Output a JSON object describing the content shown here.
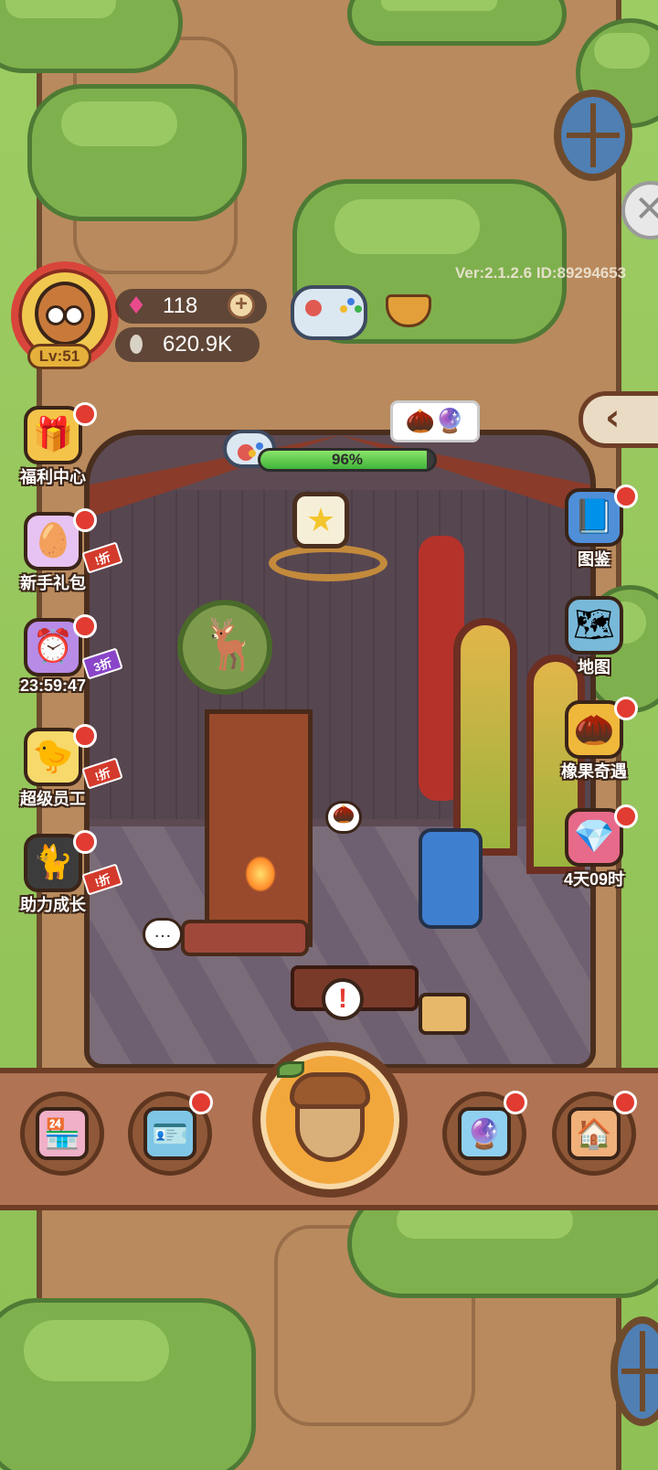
{
  "hud": {
    "level": "Lv:51",
    "gems": "118",
    "seeds": "620.9K",
    "version": "Ver:2.1.2.6 ID:89294653",
    "icons": {
      "gem": "gem-icon",
      "seed": "sunflower-seed-icon",
      "add": "plus-icon",
      "gamepad": "gamepad-icon",
      "bowl": "hotpot-icon"
    }
  },
  "room": {
    "progress": 0.96,
    "progress_label": "96%",
    "star_icon": "★",
    "alert_icon": "!",
    "chat_icon": "…"
  },
  "left_menu": [
    {
      "label": "福利中心",
      "icon": "gift-icon",
      "emoji": "🎁",
      "color": "#f4c34a",
      "badge": ""
    },
    {
      "label": "新手礼包",
      "icon": "egg-clock-icon",
      "emoji": "🥚",
      "color": "#e6c3f2",
      "badge": "!折"
    },
    {
      "label": "23:59:47",
      "icon": "alarm-clock-icon",
      "emoji": "⏰",
      "color": "#b88be6",
      "badge": "3折"
    },
    {
      "label": "超级员工",
      "icon": "chick-icon",
      "emoji": "🐤",
      "color": "#f6d96a",
      "badge": "!折"
    },
    {
      "label": "助力成长",
      "icon": "black-cat-icon",
      "emoji": "🐈",
      "color": "#3c3c3c",
      "badge": "!折"
    }
  ],
  "right_menu": [
    {
      "label": "图鉴",
      "icon": "book-icon",
      "emoji": "📘",
      "color": "#4f8fd8"
    },
    {
      "label": "地图",
      "icon": "map-icon",
      "emoji": "🗺",
      "color": "#78b8d8"
    },
    {
      "label": "橡果奇遇",
      "icon": "golden-acorn-icon",
      "emoji": "🌰",
      "color": "#f0b83a"
    },
    {
      "label": "4天09时",
      "icon": "treasure-icon",
      "emoji": "💎",
      "color": "#e86a8a"
    }
  ],
  "bottom_nav": [
    {
      "name": "shop",
      "icon": "shop-icon",
      "emoji": "🏪",
      "color": "#f0b0c8"
    },
    {
      "name": "card",
      "icon": "id-card-icon",
      "emoji": "🪪",
      "color": "#7fc6e6"
    },
    {
      "name": "snow-globe",
      "icon": "snow-globe-icon",
      "emoji": "🔮",
      "color": "#8fd0f0"
    },
    {
      "name": "house",
      "icon": "house-icon",
      "emoji": "🏠",
      "color": "#f0b07a"
    }
  ],
  "controls": {
    "close": "✕",
    "collapse": "‹"
  },
  "colors": {
    "trunk": "#b98a5d",
    "leaf": "#7fb04e",
    "accent_red": "#e23b31",
    "bar_green": "#3fb53a"
  }
}
